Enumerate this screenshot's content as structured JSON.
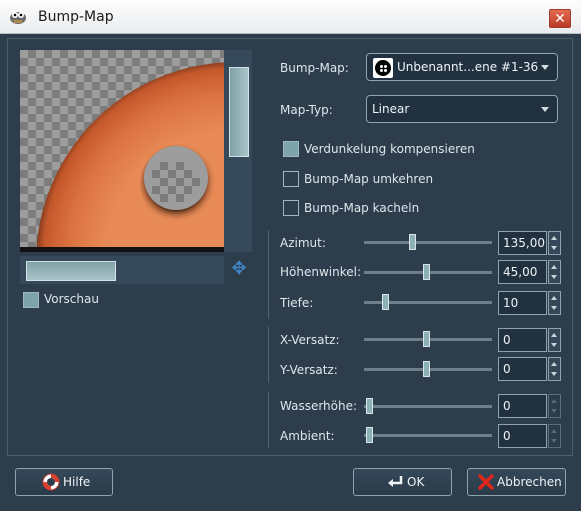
{
  "window": {
    "title": "Bump-Map",
    "close_label": "✕"
  },
  "preview": {
    "toggle_label": "Vorschau",
    "toggle_checked": true
  },
  "bumpmap": {
    "label": "Bump-Map:",
    "value": "Unbenannt...ene #1-36"
  },
  "maptype": {
    "label": "Map-Typ:",
    "value": "Linear"
  },
  "options": {
    "compensate": {
      "label": "Verdunkelung kompensieren",
      "checked": true
    },
    "invert": {
      "label": "Bump-Map umkehren",
      "checked": false
    },
    "tile": {
      "label": "Bump-Map kacheln",
      "checked": false
    }
  },
  "params": {
    "azimuth": {
      "label": "Azimut:",
      "value": "135,00"
    },
    "elevation": {
      "label": "Höhenwinkel:",
      "value": "45,00"
    },
    "depth": {
      "label": "Tiefe:",
      "value": "10"
    },
    "xoffset": {
      "label": "X-Versatz:",
      "value": "0"
    },
    "yoffset": {
      "label": "Y-Versatz:",
      "value": "0"
    },
    "waterlevel": {
      "label": "Wasserhöhe:",
      "value": "0"
    },
    "ambient": {
      "label": "Ambient:",
      "value": "0"
    }
  },
  "buttons": {
    "help": "Hilfe",
    "ok": "OK",
    "cancel": "Abbrechen"
  },
  "icons": {
    "app": "gimp-icon",
    "brush": "brush-pattern-icon",
    "help": "lifebuoy-icon",
    "ok": "return-arrow-icon",
    "cancel": "red-x-icon",
    "navigate": "move-arrows-icon"
  }
}
